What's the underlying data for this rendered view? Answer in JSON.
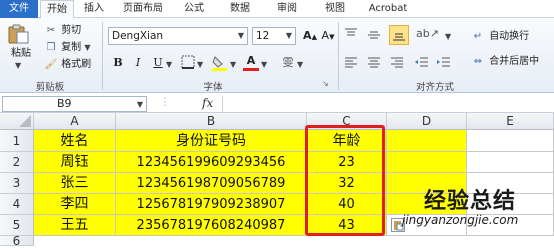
{
  "tabs": [
    "文件",
    "开始",
    "插入",
    "页面布局",
    "公式",
    "数据",
    "审阅",
    "视图",
    "Acrobat"
  ],
  "clipboard": {
    "paste_label": "粘贴",
    "cut_label": "剪切",
    "copy_label": "复制",
    "format_painter_label": "格式刷",
    "group_label": "剪贴板"
  },
  "font": {
    "name": "DengXian",
    "size": "12",
    "group_label": "字体"
  },
  "alignment": {
    "wrap_label": "自动换行",
    "merge_label": "合并后居中",
    "group_label": "对齐方式"
  },
  "formula_bar": {
    "name_box": "B9",
    "fx": "fx",
    "value": ""
  },
  "columns": [
    "A",
    "B",
    "C",
    "D",
    "E"
  ],
  "rows": [
    "1",
    "2",
    "3",
    "4",
    "5",
    "6"
  ],
  "table": {
    "header": [
      "姓名",
      "身份证号码",
      "年龄"
    ],
    "rows": [
      [
        "周钰",
        "123456199609293456",
        "23"
      ],
      [
        "张三",
        "123456198709056789",
        "32"
      ],
      [
        "李四",
        "125678197909238907",
        "40"
      ],
      [
        "王五",
        "235678197608240987",
        "43"
      ]
    ]
  },
  "watermark": {
    "title": "经验总结",
    "url": "jingyanzongjie.com"
  },
  "colors": {
    "highlight": "#ffff00",
    "annotation_border": "#e01e1e",
    "file_tab": "#2a6fc9"
  }
}
